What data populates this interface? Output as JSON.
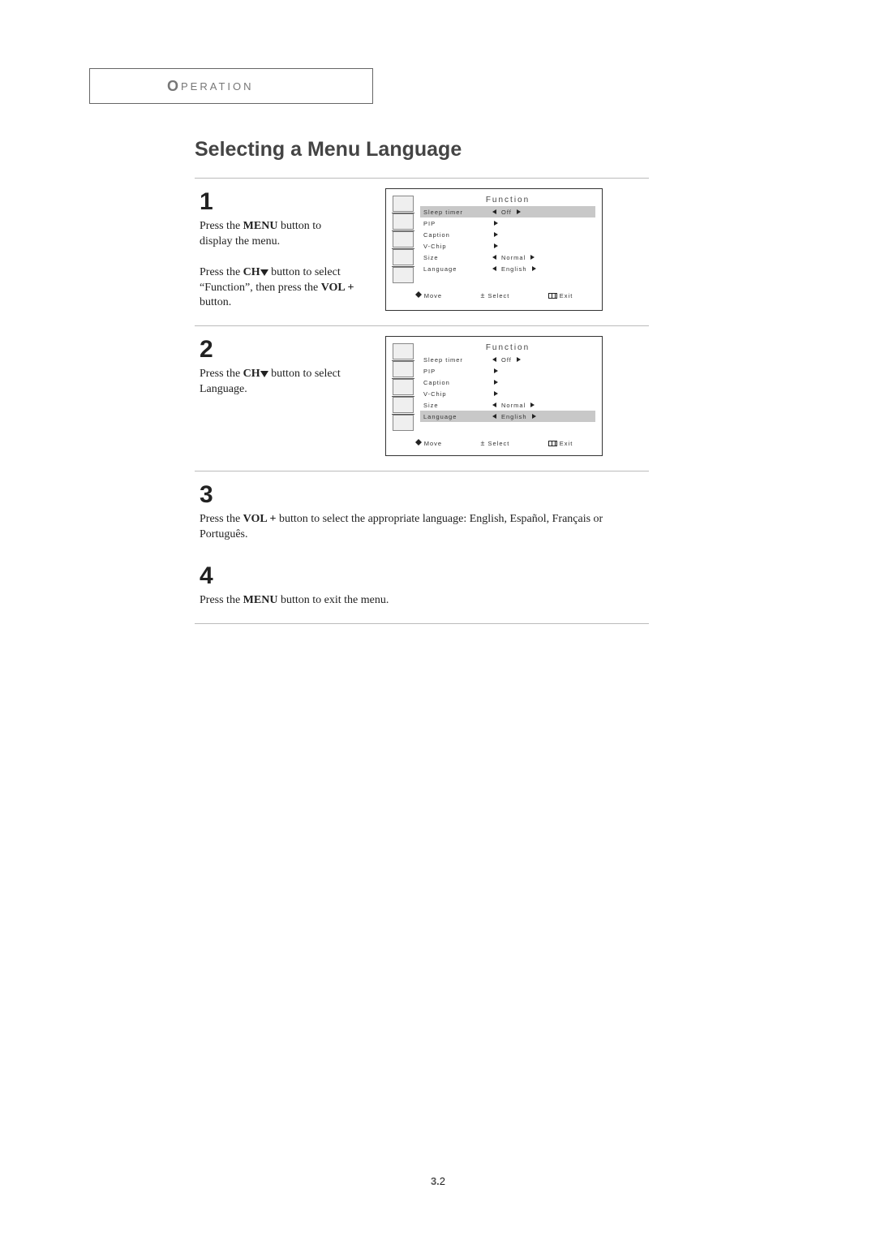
{
  "section_header": {
    "first": "O",
    "rest": "peration"
  },
  "main_title": "Selecting a Menu Language",
  "steps": {
    "s1": {
      "num": "1",
      "line1a": "Press the ",
      "line1b": "MENU",
      "line1c": " button to display the menu.",
      "line2a": "Press the ",
      "line2b": "CH",
      "line2c": " button to select “Function”, then press the ",
      "line2d": "VOL +",
      "line2e": " button."
    },
    "s2": {
      "num": "2",
      "line1a": "Press the ",
      "line1b": "CH",
      "line1c": " button to select Language."
    },
    "s3": {
      "num": "3",
      "line1a": "Press the ",
      "line1b": "VOL +",
      "line1c": " button to select the appropriate language: English, Español, Français or Português."
    },
    "s4": {
      "num": "4",
      "line1a": "Press the ",
      "line1b": "MENU",
      "line1c": " button to exit the menu."
    }
  },
  "osd": {
    "title": "Function",
    "items": [
      {
        "label": "Sleep timer",
        "value": "Off",
        "left": true,
        "right": true
      },
      {
        "label": "PIP",
        "value": "",
        "left": false,
        "right": true
      },
      {
        "label": "Caption",
        "value": "",
        "left": false,
        "right": true
      },
      {
        "label": "V-Chip",
        "value": "",
        "left": false,
        "right": true
      },
      {
        "label": "Size",
        "value": "Normal",
        "left": true,
        "right": true
      },
      {
        "label": "Language",
        "value": "English",
        "left": true,
        "right": true
      }
    ],
    "footer": {
      "move": "Move",
      "select": "Select",
      "exit": "Exit"
    }
  },
  "highlight_index": {
    "step1": 0,
    "step2": 5
  },
  "page_number": {
    "chapter": "3.",
    "page": "2"
  }
}
